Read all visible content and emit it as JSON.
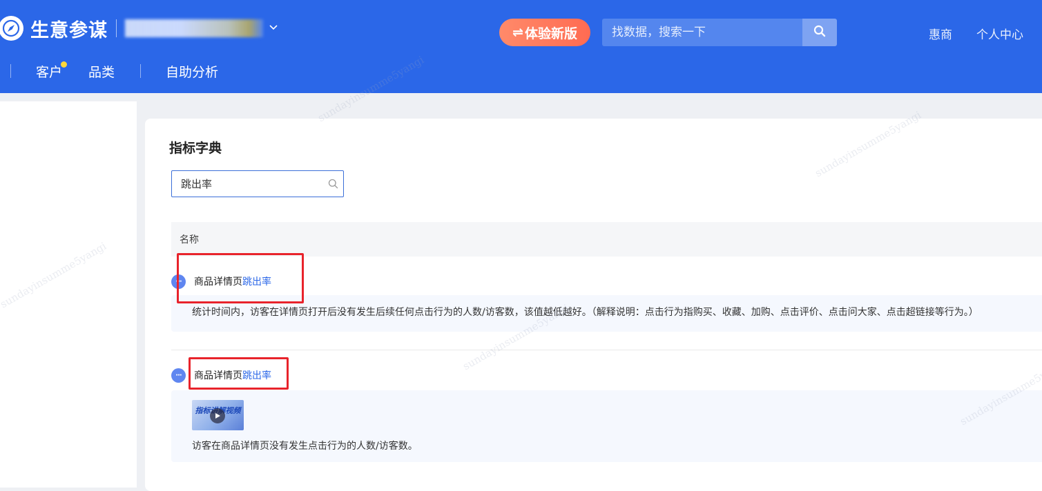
{
  "header": {
    "brand": "生意参谋",
    "shop_dropdown_icon": "chevron-down-icon",
    "new_version_label": "体验新版",
    "new_version_icon": "⇌",
    "search_placeholder": "找数据，搜索一下",
    "links": [
      "惠商",
      "个人中心"
    ],
    "nav": [
      "客户",
      "品类",
      "自助分析"
    ],
    "colors": {
      "brand_blue": "#2b67e8",
      "badge_dot": "#ffd83a",
      "new_version": "#ff6b52"
    }
  },
  "dictionary": {
    "title": "指标字典",
    "search_value": "跳出率",
    "column_name": "名称",
    "results": [
      {
        "name_prefix": "商品详情页",
        "name_highlight": "跳出率",
        "icon": "chat-bubble-icon",
        "description": "统计时间内，访客在详情页打开后没有发生后续任何点击行为的人数/访客数，该值越低越好。（解释说明：点击行为指购买、收藏、加购、点击评价、点击问大家、点击超链接等行为。）"
      },
      {
        "name_prefix": "商品详情页",
        "name_highlight": "跳出率",
        "icon": "chat-bubble-icon",
        "video_label": "指标讲解视频",
        "description": "访客在商品详情页没有发生点击行为的人数/访客数。"
      }
    ]
  },
  "watermark_text": "sundayinsumme5yangi"
}
